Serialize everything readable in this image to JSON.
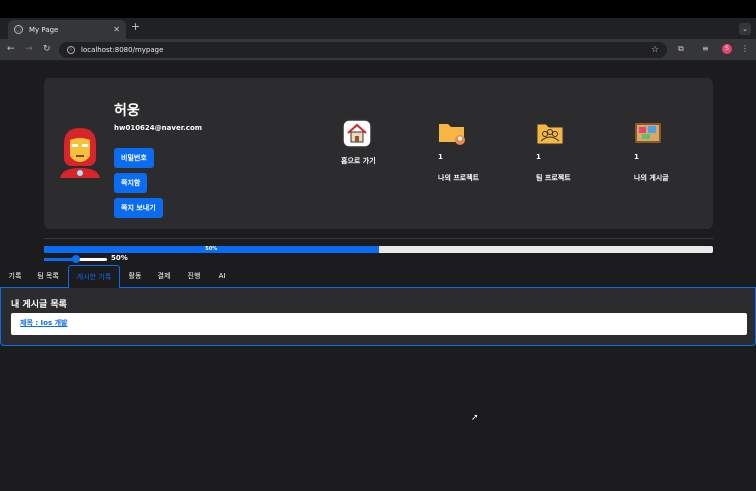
{
  "browser": {
    "tab_title": "My Page",
    "new_tab": "+",
    "url": "localhost:8080/mypage",
    "profile_initial": "S"
  },
  "profile": {
    "name": "허웅",
    "email": "hw010624@naver.com",
    "buttons": [
      "비밀번호",
      "쪽지함",
      "쪽지 보내기"
    ]
  },
  "stats": {
    "home_label": "홈으로 가기",
    "items": [
      {
        "count": "1",
        "label": "나의 프로젝트",
        "icon": "folder-user-icon"
      },
      {
        "count": "1",
        "label": "팀 프로젝트",
        "icon": "team-folder-icon"
      },
      {
        "count": "1",
        "label": "나의 게시글",
        "icon": "bulletin-board-icon"
      }
    ]
  },
  "progress": {
    "value": 0.5,
    "label": "50%"
  },
  "slider": {
    "value": 0.5,
    "label": "50%"
  },
  "tabs": [
    "기록",
    "팀 목록",
    "게시한 기록",
    "활동",
    "결제",
    "진행",
    "AI"
  ],
  "active_tab": "게시한 기록",
  "panel": {
    "title": "내 게시글 목록",
    "posts": [
      "제목 : Ios 개발"
    ]
  },
  "colors": {
    "accent": "#0a6cf0",
    "background": "#1c1c1e",
    "card": "#2c2c2e"
  }
}
